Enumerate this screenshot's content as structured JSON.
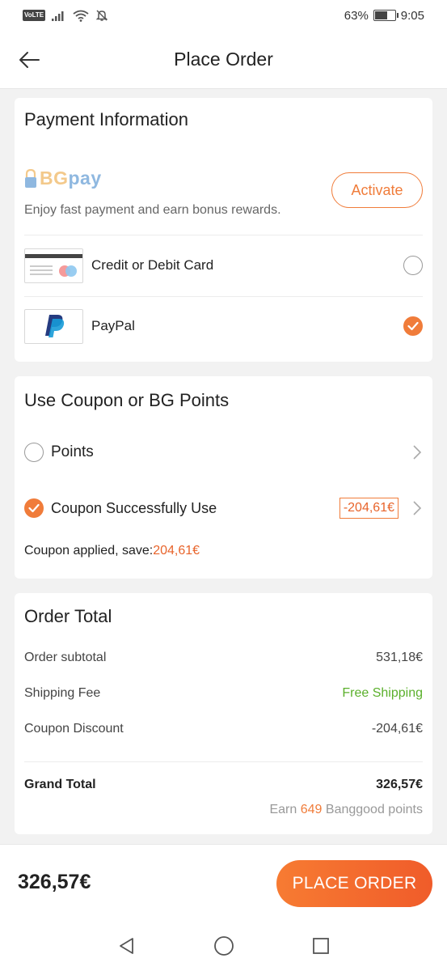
{
  "status_bar": {
    "volte": "VoLTE",
    "battery_percent": "63%",
    "battery_level": 0.63,
    "time": "9:05",
    "icons": [
      "volte-icon",
      "signal-icon",
      "wifi-icon",
      "notifications-off-icon",
      "battery-icon"
    ]
  },
  "header": {
    "title": "Place Order",
    "back_icon": "back-arrow-icon"
  },
  "payment": {
    "title": "Payment Information",
    "bgpay_logo": "BGpay",
    "bgpay_desc": "Enjoy fast payment and earn bonus rewards.",
    "activate_label": "Activate",
    "methods": [
      {
        "label": "Credit or Debit Card",
        "selected": false,
        "icon": "credit-card-icon"
      },
      {
        "label": "PayPal",
        "selected": true,
        "icon": "paypal-icon"
      }
    ]
  },
  "coupon": {
    "title": "Use Coupon or BG Points",
    "points_label": "Points",
    "coupon_label": "Coupon Successfully Use",
    "coupon_value": "-204,61€",
    "note_prefix": "Coupon applied, save:",
    "note_amount": "204,61€"
  },
  "order_total": {
    "title": "Order Total",
    "rows": [
      {
        "label": "Order subtotal",
        "value": "531,18€"
      },
      {
        "label": "Shipping Fee",
        "value": "Free Shipping"
      },
      {
        "label": "Coupon Discount",
        "value": "-204,61€"
      }
    ],
    "grand_label": "Grand Total",
    "grand_value": "326,57€",
    "earn_prefix": "Earn",
    "earn_points": "649",
    "earn_suffix": "Banggood points"
  },
  "bottom": {
    "total": "326,57€",
    "place_order_label": "PLACE ORDER"
  },
  "nav": {
    "icons": [
      "nav-back-icon",
      "nav-home-icon",
      "nav-recents-icon"
    ]
  },
  "colors": {
    "accent": "#f07c3a",
    "discount": "#e8642b",
    "free_shipping": "#5bb02c"
  }
}
